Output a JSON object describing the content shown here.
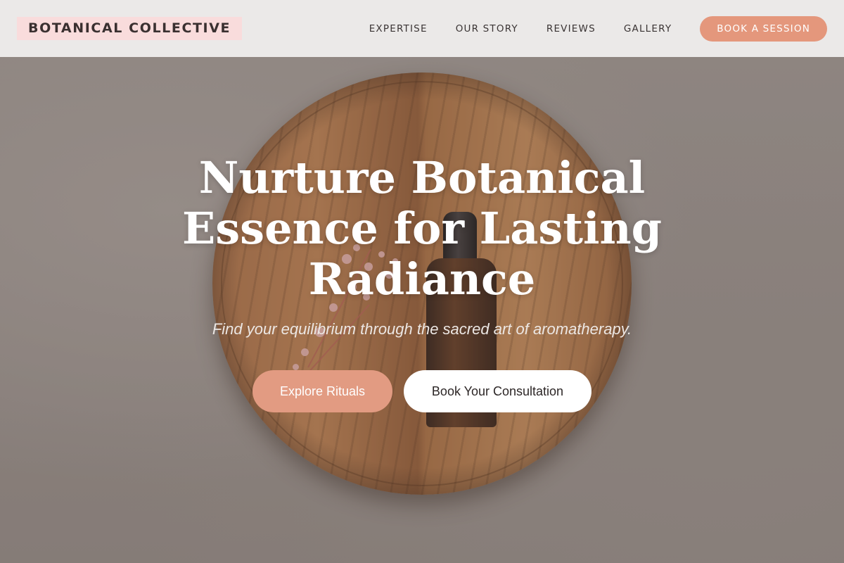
{
  "header": {
    "logo": "BOTANICAL COLLECTIVE",
    "nav": [
      {
        "label": "EXPERTISE"
      },
      {
        "label": "OUR STORY"
      },
      {
        "label": "REVIEWS"
      },
      {
        "label": "GALLERY"
      }
    ],
    "cta_label": "BOOK A SESSION"
  },
  "hero": {
    "title": "Nurture Botanical Essence for Lasting Radiance",
    "subtitle": "Find your equilibrium through the sacred art of aromatherapy.",
    "primary_cta": "Explore Rituals",
    "secondary_cta": "Book Your Consultation"
  },
  "colors": {
    "accent": "#e4977c",
    "logo_bg": "#f9dcdc",
    "header_bg": "#ebe9e8",
    "text_dark": "#3a3030"
  }
}
